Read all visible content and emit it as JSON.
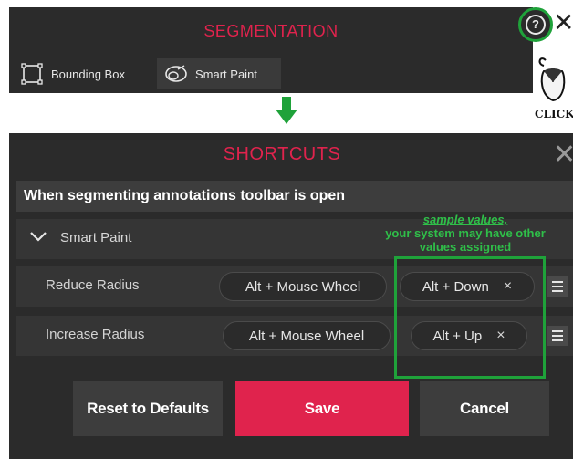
{
  "segmentation": {
    "title": "SEGMENTATION",
    "tools": [
      {
        "label": "Bounding Box",
        "icon": "bounding-box-icon"
      },
      {
        "label": "Smart Paint",
        "icon": "smart-paint-icon"
      }
    ],
    "help_icon": "help-icon",
    "close_icon": "close-icon"
  },
  "illustration": {
    "click_label": "CLICK",
    "icon": "mouse-icon"
  },
  "shortcuts": {
    "title": "SHORTCUTS",
    "close_icon": "close-icon",
    "section": "When segmenting annotations toolbar is open",
    "group": {
      "label": "Smart Paint",
      "icon": "chevron-down-icon"
    },
    "rows": [
      {
        "name": "Reduce Radius",
        "default": "Alt + Mouse Wheel",
        "custom": "Alt + Down",
        "remove": "×"
      },
      {
        "name": "Increase Radius",
        "default": "Alt + Mouse Wheel",
        "custom": "Alt + Up",
        "remove": "×"
      }
    ],
    "buttons": {
      "reset": "Reset to Defaults",
      "save": "Save",
      "cancel": "Cancel"
    }
  },
  "annotation": {
    "line1": "sample values,",
    "line2": "your system may have other",
    "line3": "values assigned"
  },
  "colors": {
    "accent_red": "#e0234d",
    "annotation_green": "#1fa23a",
    "panel_dark": "#2b2b2b"
  }
}
